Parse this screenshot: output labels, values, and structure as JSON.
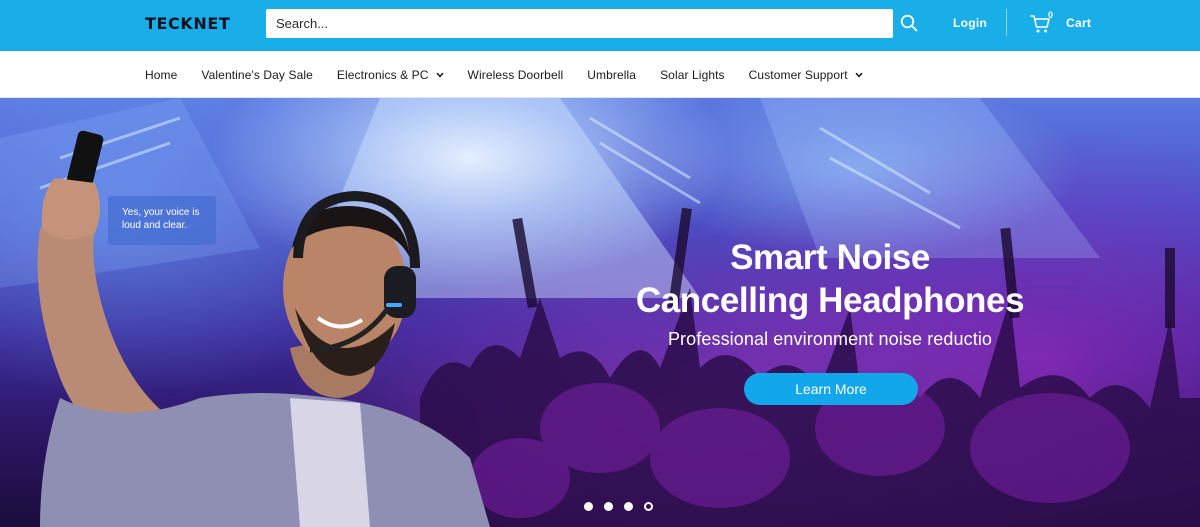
{
  "header": {
    "logo_text": "TECKNET",
    "search": {
      "placeholder": "Search..."
    },
    "login_label": "Login",
    "cart": {
      "count": "0",
      "label": "Cart"
    },
    "bg_color": "#1aaee8"
  },
  "nav": {
    "items": [
      {
        "label": "Home",
        "has_dropdown": false
      },
      {
        "label": "Valentine's Day Sale",
        "has_dropdown": false
      },
      {
        "label": "Electronics & PC",
        "has_dropdown": true
      },
      {
        "label": "Wireless Doorbell",
        "has_dropdown": false
      },
      {
        "label": "Umbrella",
        "has_dropdown": false
      },
      {
        "label": "Solar Lights",
        "has_dropdown": false
      },
      {
        "label": "Customer Support",
        "has_dropdown": true
      }
    ]
  },
  "hero": {
    "bubble_text": "Yes, your voice is loud and clear.",
    "title_line1": "Smart Noise",
    "title_line2": "Cancelling Headphones",
    "subtitle": "Professional environment noise reductio",
    "cta_label": "Learn More",
    "cta_color": "#12a6ea",
    "slides": {
      "total": 4,
      "active_index": 3
    }
  },
  "icons": {
    "search": "search-icon",
    "cart": "cart-icon",
    "dropdown": "chevron-down-icon"
  }
}
